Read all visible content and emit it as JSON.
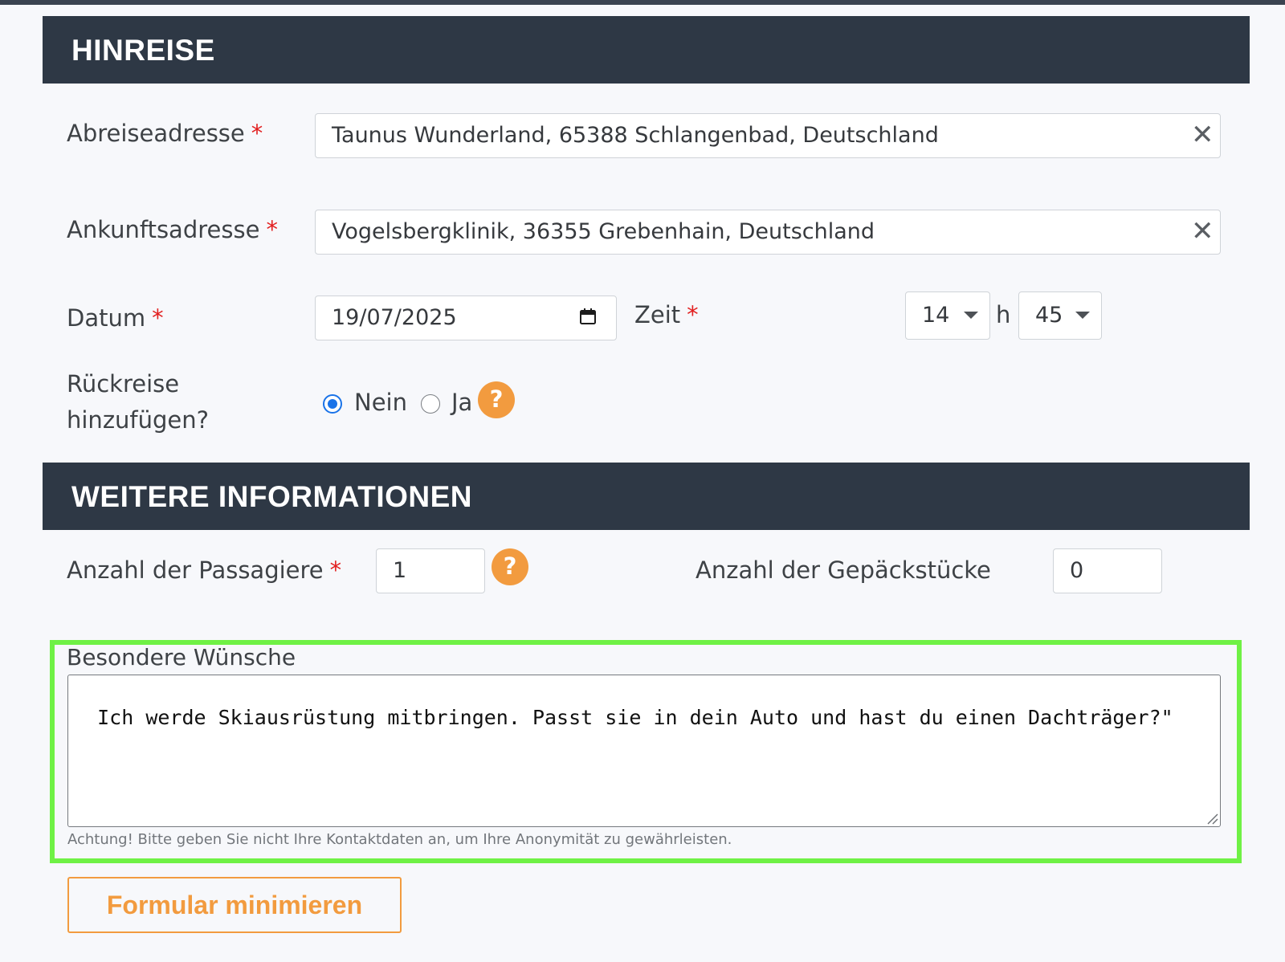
{
  "outbound": {
    "header": "HINREISE",
    "departure": {
      "label": "Abreiseadresse",
      "required_mark": "*",
      "value": "Taunus Wunderland, 65388 Schlangenbad, Deutschland",
      "clear_glyph": "✕"
    },
    "arrival": {
      "label": "Ankunftsadresse",
      "required_mark": "*",
      "value": "Vogelsbergklinik, 36355 Grebenhain, Deutschland",
      "clear_glyph": "✕"
    },
    "date": {
      "label": "Datum",
      "required_mark": "*",
      "value": "19/07/2025"
    },
    "time": {
      "label": "Zeit",
      "required_mark": "*",
      "hour": "14",
      "separator": "h",
      "minute": "45"
    },
    "return_trip": {
      "label_line1": "Rückreise",
      "label_line2": "hinzufügen?",
      "options": [
        {
          "label": "Nein",
          "selected": true
        },
        {
          "label": "Ja",
          "selected": false
        }
      ],
      "help_glyph": "?"
    }
  },
  "more_info": {
    "header": "WEITERE INFORMATIONEN",
    "passengers": {
      "label": "Anzahl der Passagiere",
      "required_mark": "*",
      "value": "1",
      "help_glyph": "?"
    },
    "luggage": {
      "label": "Anzahl der Gepäckstücke",
      "value": "0"
    },
    "special_requests": {
      "label": "Besondere Wünsche",
      "value": "Ich werde Skiausrüstung mitbringen. Passt sie in dein Auto und hast du einen Dachträger?\"",
      "hint": "Achtung! Bitte geben Sie nicht Ihre Kontaktdaten an, um Ihre Anonymität zu gewährleisten."
    }
  },
  "minimize_button": "Formular minimieren",
  "colors": {
    "header_bg": "#2e3845",
    "accent_orange": "#f29b3f",
    "required_red": "#e21f1f",
    "radio_blue": "#1a73e8",
    "highlight_green": "#6ff145"
  }
}
